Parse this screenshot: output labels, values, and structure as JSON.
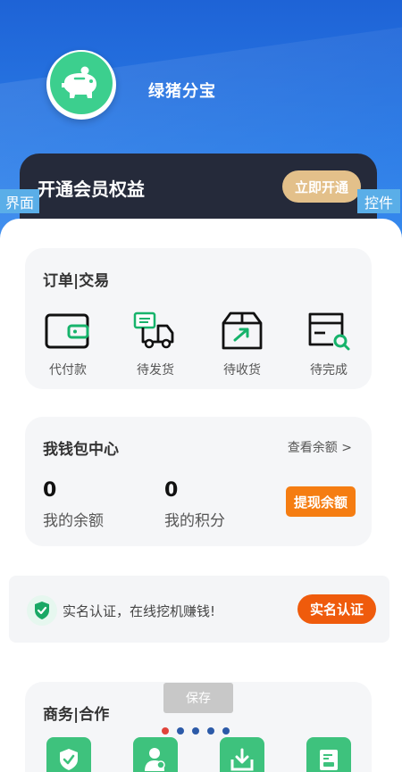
{
  "profile": {
    "username": "绿猪分宝"
  },
  "vip": {
    "title": "开通会员权益",
    "button": "立即开通"
  },
  "overlay_tags": {
    "left": "界面",
    "right": "控件"
  },
  "orders": {
    "title": "订单|交易",
    "items": [
      {
        "label": "代付款",
        "icon": "wallet-icon"
      },
      {
        "label": "待发货",
        "icon": "truck-icon"
      },
      {
        "label": "待收货",
        "icon": "box-icon"
      },
      {
        "label": "待完成",
        "icon": "card-search-icon"
      }
    ]
  },
  "wallet": {
    "title": "我钱包中心",
    "link": "查看余额 >",
    "balance_value": "0",
    "balance_label": "我的余额",
    "points_value": "0",
    "points_label": "我的积分",
    "withdraw_button": "提现余额"
  },
  "auth": {
    "text": "实名认证，在线挖机赚钱!",
    "button": "实名认证",
    "icon": "shield-check-icon"
  },
  "business": {
    "title": "商务|合作"
  },
  "save_button": "保存",
  "carousel": {
    "count": 5,
    "active_index": 0
  },
  "colors": {
    "header_blue": "#2a7be6",
    "vip_dark": "#252a3a",
    "vip_gold": "#e3c08a",
    "accent_orange": "#f57d12",
    "auth_orange": "#ef5b0c",
    "brand_green": "#3ec27d"
  }
}
